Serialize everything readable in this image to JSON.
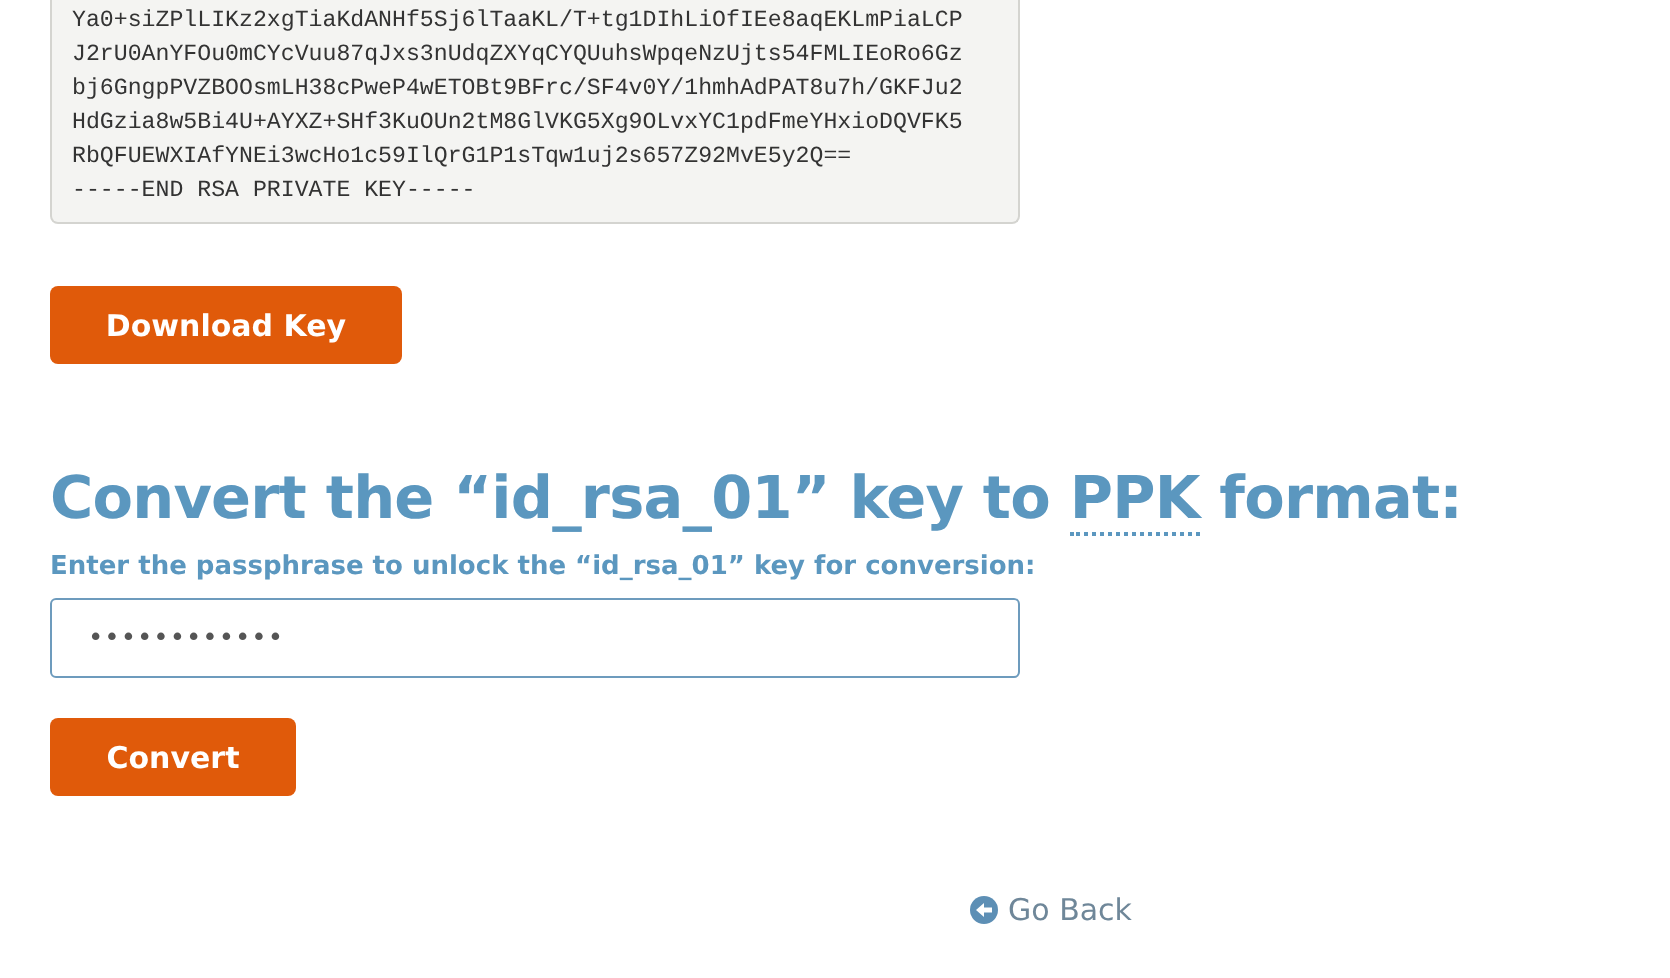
{
  "key_block": {
    "lines": [
      "Ya0+siZPlLIKz2xgTiaKdANHf5Sj6lTaaKL/T+tg1DIhLiOfIEe8aqEKLmPiaLCP",
      "J2rU0AnYFOu0mCYcVuu87qJxs3nUdqZXYqCYQUuhsWpqeNzUjts54FMLIEoRo6Gz",
      "bj6GngpPVZBOOsmLH38cPweP4wETOBt9BFrc/SF4v0Y/1hmhAdPAT8u7h/GKFJu2",
      "HdGzia8w5Bi4U+AYXZ+SHf3KuOUn2tM8GlVKG5Xg9OLvxYC1pdFmeYHxioDQVFK5",
      "RbQFUEWXIAfYNEi3wcHo1c59IlQrG1P1sTqw1uj2s657Z92MvE5y2Q==",
      "-----END RSA PRIVATE KEY-----"
    ]
  },
  "download_button": "Download Key",
  "convert_section": {
    "heading_before": "Convert the “id_rsa_01” key to",
    "heading_abbr": "PPK",
    "heading_after": "format:",
    "label": "Enter the passphrase to unlock the “id_rsa_01” key for conversion:",
    "passphrase": {
      "value": "••••••••••••"
    },
    "button": "Convert"
  },
  "go_back": "Go Back"
}
